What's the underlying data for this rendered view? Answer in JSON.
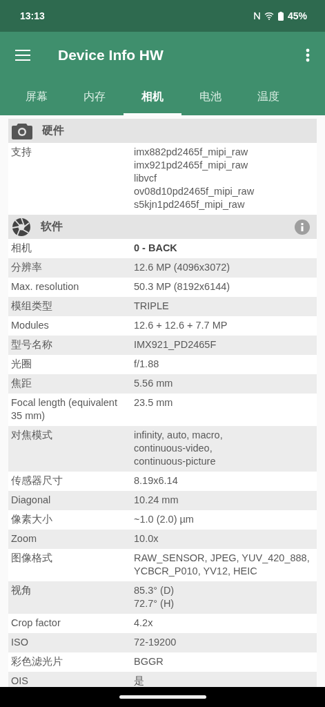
{
  "status_bar": {
    "time": "13:13",
    "battery": "45%"
  },
  "app_bar": {
    "title": "Device Info HW"
  },
  "tabs": [
    {
      "label": "屏幕",
      "selected": false
    },
    {
      "label": "内存",
      "selected": false
    },
    {
      "label": "相机",
      "selected": true
    },
    {
      "label": "电池",
      "selected": false
    },
    {
      "label": "温度",
      "selected": false
    }
  ],
  "sections": [
    {
      "title": "硬件",
      "info": false,
      "rows": [
        {
          "label": "支持",
          "value": "imx882pd2465f_mipi_raw\nimx921pd2465f_mipi_raw\nlibvcf\nov08d10pd2465f_mipi_raw\ns5kjn1pd2465f_mipi_raw",
          "bold": false
        }
      ]
    },
    {
      "title": "软件",
      "info": true,
      "rows": [
        {
          "label": "相机",
          "value": "0 - BACK",
          "bold": true
        },
        {
          "label": "分辨率",
          "value": "12.6 MP (4096x3072)",
          "bold": false
        },
        {
          "label": "Max. resolution",
          "value": "50.3 MP (8192x6144)",
          "bold": false
        },
        {
          "label": "模组类型",
          "value": "TRIPLE",
          "bold": false
        },
        {
          "label": "Modules",
          "value": "12.6 + 12.6 + 7.7 MP",
          "bold": false
        },
        {
          "label": "型号名称",
          "value": "IMX921_PD2465F",
          "bold": false
        },
        {
          "label": "光圈",
          "value": "f/1.88",
          "bold": false
        },
        {
          "label": "焦距",
          "value": "5.56 mm",
          "bold": false
        },
        {
          "label": "Focal length (equivalent 35 mm)",
          "value": "23.5 mm",
          "bold": false
        },
        {
          "label": "对焦模式",
          "value": "infinity, auto, macro,\ncontinuous-video,\ncontinuous-picture",
          "bold": false
        },
        {
          "label": "传感器尺寸",
          "value": "8.19x6.14",
          "bold": false
        },
        {
          "label": "Diagonal",
          "value": "10.24 mm",
          "bold": false
        },
        {
          "label": "像素大小",
          "value": "~1.0 (2.0) µm",
          "bold": false
        },
        {
          "label": "Zoom",
          "value": "10.0x",
          "bold": false
        },
        {
          "label": "图像格式",
          "value": "RAW_SENSOR, JPEG, YUV_420_888,\nYCBCR_P010, YV12, HEIC",
          "bold": false
        },
        {
          "label": "视角",
          "value": "85.3° (D)\n72.7° (H)",
          "bold": false
        },
        {
          "label": "Crop factor",
          "value": "4.2x",
          "bold": false
        },
        {
          "label": "ISO",
          "value": "72-19200",
          "bold": false
        },
        {
          "label": "彩色滤光片",
          "value": "BGGR",
          "bold": false
        },
        {
          "label": "OIS",
          "value": "是",
          "bold": false
        }
      ]
    }
  ]
}
